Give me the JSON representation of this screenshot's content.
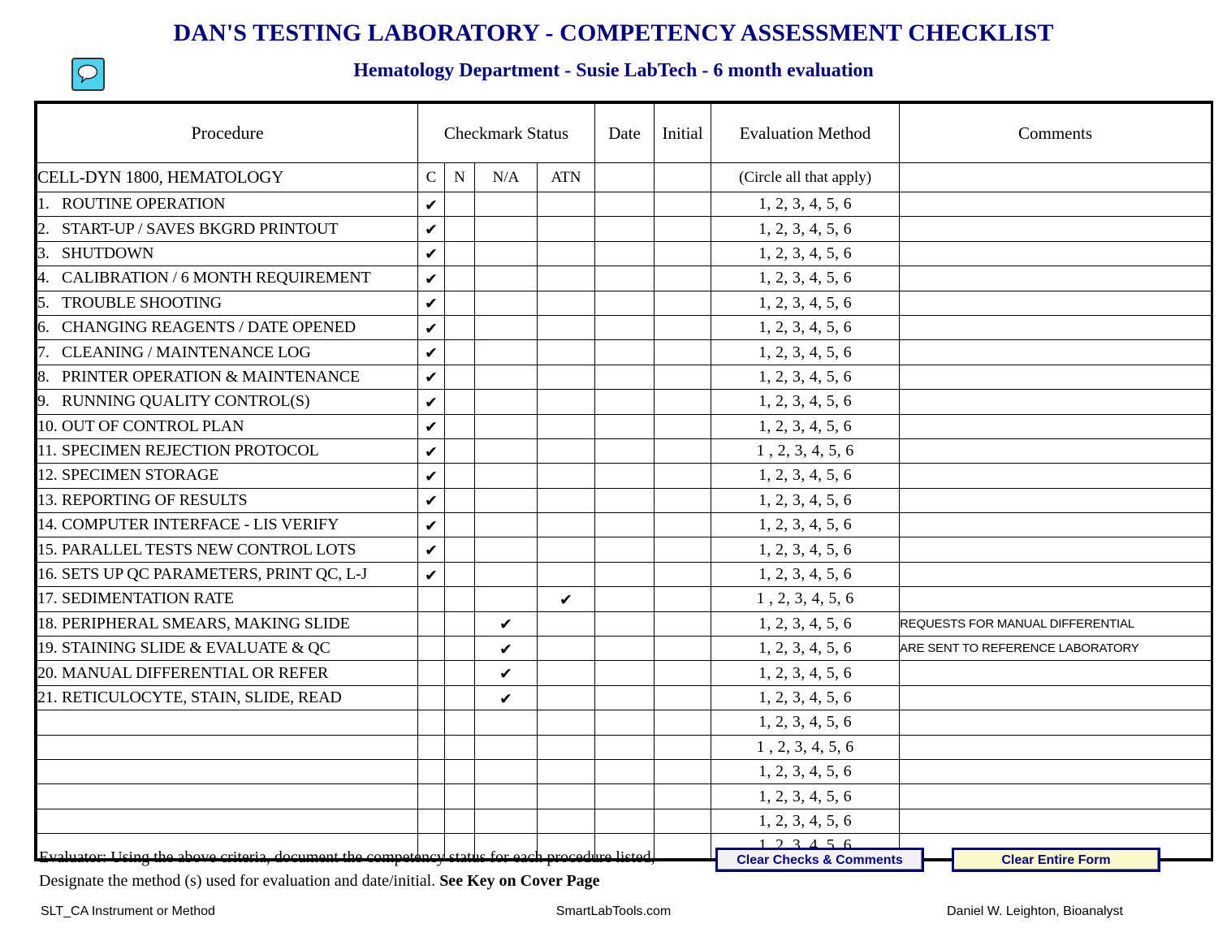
{
  "header": {
    "title": "DAN'S TESTING LABORATORY - COMPETENCY ASSESSMENT CHECKLIST",
    "subtitle": "Hematology Department - Susie LabTech - 6 month evaluation",
    "icon": "comment-bubble-icon",
    "title_color": "#000080",
    "icon_color": "#4DD2EE"
  },
  "table": {
    "columns": {
      "procedure": "Procedure",
      "checkmark_status": "Checkmark Status",
      "date": "Date",
      "initial": "Initial",
      "evaluation_method": "Evaluation Method",
      "comments": "Comments"
    },
    "subcolumns": {
      "c": "C",
      "n": "N",
      "na": "N/A",
      "atn": "ATN"
    },
    "section_title": "CELL-DYN 1800, HEMATOLOGY",
    "circle_note": "(Circle all that apply)",
    "eval_options": "1,  2,  3,  4,  5,  6",
    "check_glyph": "✔",
    "rows": [
      {
        "num": "1.",
        "name": "ROUTINE OPERATION",
        "c": "✔",
        "n": "",
        "na": "",
        "atn": "",
        "date": "",
        "initial": "",
        "eval": "1,  2,  3,  4,  5,  6",
        "comment": ""
      },
      {
        "num": "2.",
        "name": "START-UP / SAVES BKGRD PRINTOUT",
        "c": "✔",
        "n": "",
        "na": "",
        "atn": "",
        "date": "",
        "initial": "",
        "eval": "1,  2,  3,  4,  5,  6",
        "comment": ""
      },
      {
        "num": "3.",
        "name": "SHUTDOWN",
        "c": "✔",
        "n": "",
        "na": "",
        "atn": "",
        "date": "",
        "initial": "",
        "eval": "1,  2,  3,  4,  5,  6",
        "comment": ""
      },
      {
        "num": "4.",
        "name": "CALIBRATION / 6 MONTH REQUIREMENT",
        "c": "✔",
        "n": "",
        "na": "",
        "atn": "",
        "date": "",
        "initial": "",
        "eval": "1,  2,  3,  4,  5,  6",
        "comment": ""
      },
      {
        "num": "5.",
        "name": "TROUBLE SHOOTING",
        "c": "✔",
        "n": "",
        "na": "",
        "atn": "",
        "date": "",
        "initial": "",
        "eval": "1,  2,  3,  4,  5,  6",
        "comment": ""
      },
      {
        "num": "6.",
        "name": "CHANGING REAGENTS / DATE OPENED",
        "c": "✔",
        "n": "",
        "na": "",
        "atn": "",
        "date": "",
        "initial": "",
        "eval": "1,  2,  3,  4,  5,  6",
        "comment": ""
      },
      {
        "num": "7.",
        "name": "CLEANING / MAINTENANCE LOG",
        "c": "✔",
        "n": "",
        "na": "",
        "atn": "",
        "date": "",
        "initial": "",
        "eval": "1,  2,  3,  4,  5,  6",
        "comment": ""
      },
      {
        "num": "8.",
        "name": "PRINTER OPERATION & MAINTENANCE",
        "c": "✔",
        "n": "",
        "na": "",
        "atn": "",
        "date": "",
        "initial": "",
        "eval": "1,  2,  3,  4,  5,  6",
        "comment": ""
      },
      {
        "num": "9.",
        "name": "RUNNING QUALITY CONTROL(S)",
        "c": "✔",
        "n": "",
        "na": "",
        "atn": "",
        "date": "",
        "initial": "",
        "eval": "1,  2,  3,  4,  5,  6",
        "comment": ""
      },
      {
        "num": "10.",
        "name": "OUT OF CONTROL PLAN",
        "c": "✔",
        "n": "",
        "na": "",
        "atn": "",
        "date": "",
        "initial": "",
        "eval": "1,  2,  3,  4,  5,  6",
        "comment": ""
      },
      {
        "num": "11.",
        "name": "SPECIMEN REJECTION PROTOCOL",
        "c": "✔",
        "n": "",
        "na": "",
        "atn": "",
        "date": "",
        "initial": "",
        "eval": "1 ,  2,  3,  4,  5,  6",
        "comment": ""
      },
      {
        "num": "12.",
        "name": "SPECIMEN STORAGE",
        "c": "✔",
        "n": "",
        "na": "",
        "atn": "",
        "date": "",
        "initial": "",
        "eval": "1,  2,  3,  4,  5,  6",
        "comment": ""
      },
      {
        "num": "13.",
        "name": "REPORTING OF RESULTS",
        "c": "✔",
        "n": "",
        "na": "",
        "atn": "",
        "date": "",
        "initial": "",
        "eval": "1,  2,  3,  4,  5,  6",
        "comment": ""
      },
      {
        "num": "14.",
        "name": "COMPUTER INTERFACE - LIS VERIFY",
        "c": "✔",
        "n": "",
        "na": "",
        "atn": "",
        "date": "",
        "initial": "",
        "eval": "1,  2,  3,  4,  5,  6",
        "comment": ""
      },
      {
        "num": "15.",
        "name": "PARALLEL TESTS NEW CONTROL LOTS",
        "c": "✔",
        "n": "",
        "na": "",
        "atn": "",
        "date": "",
        "initial": "",
        "eval": "1,  2,  3,  4,  5,  6",
        "comment": ""
      },
      {
        "num": "16.",
        "name": "SETS UP QC PARAMETERS, PRINT QC, L-J",
        "c": "✔",
        "n": "",
        "na": "",
        "atn": "",
        "date": "",
        "initial": "",
        "eval": "1,  2,  3,  4,  5,  6",
        "comment": ""
      },
      {
        "num": "17.",
        "name": "SEDIMENTATION RATE",
        "c": "",
        "n": "",
        "na": "",
        "atn": "✔",
        "date": "",
        "initial": "",
        "eval": "1 ,  2,  3,  4,  5,  6",
        "comment": ""
      },
      {
        "num": "18.",
        "name": "PERIPHERAL SMEARS, MAKING SLIDE",
        "c": "",
        "n": "",
        "na": "✔",
        "atn": "",
        "date": "",
        "initial": "",
        "eval": "1,  2,  3,  4,  5,  6",
        "comment": "REQUESTS FOR MANUAL DIFFERENTIAL"
      },
      {
        "num": "19.",
        "name": "STAINING SLIDE & EVALUATE & QC",
        "c": "",
        "n": "",
        "na": "✔",
        "atn": "",
        "date": "",
        "initial": "",
        "eval": "1,  2,  3,  4,  5,  6",
        "comment": "ARE SENT TO REFERENCE LABORATORY"
      },
      {
        "num": "20.",
        "name": "MANUAL DIFFERENTIAL OR REFER",
        "c": "",
        "n": "",
        "na": "✔",
        "atn": "",
        "date": "",
        "initial": "",
        "eval": "1,  2,  3,  4,  5,  6",
        "comment": ""
      },
      {
        "num": "21.",
        "name": "RETICULOCYTE, STAIN, SLIDE, READ",
        "c": "",
        "n": "",
        "na": "✔",
        "atn": "",
        "date": "",
        "initial": "",
        "eval": "1,  2,  3,  4,  5,  6",
        "comment": ""
      },
      {
        "num": "",
        "name": "",
        "c": "",
        "n": "",
        "na": "",
        "atn": "",
        "date": "",
        "initial": "",
        "eval": "1,  2,  3,  4,  5,  6",
        "comment": ""
      },
      {
        "num": "",
        "name": "",
        "c": "",
        "n": "",
        "na": "",
        "atn": "",
        "date": "",
        "initial": "",
        "eval": "1 ,  2,  3,  4,  5,  6",
        "comment": ""
      },
      {
        "num": "",
        "name": "",
        "c": "",
        "n": "",
        "na": "",
        "atn": "",
        "date": "",
        "initial": "",
        "eval": "1,  2,  3,  4,  5,  6",
        "comment": ""
      },
      {
        "num": "",
        "name": "",
        "c": "",
        "n": "",
        "na": "",
        "atn": "",
        "date": "",
        "initial": "",
        "eval": "1,  2,  3,  4,  5,  6",
        "comment": ""
      },
      {
        "num": "",
        "name": "",
        "c": "",
        "n": "",
        "na": "",
        "atn": "",
        "date": "",
        "initial": "",
        "eval": "1,  2,  3,  4,  5,  6",
        "comment": ""
      },
      {
        "num": "",
        "name": "",
        "c": "",
        "n": "",
        "na": "",
        "atn": "",
        "date": "",
        "initial": "",
        "eval": "1,  2,  3,  4,  5,  6",
        "comment": ""
      }
    ]
  },
  "bottom": {
    "evaluator_line1": "Evaluator: Using the above criteria, document the competency status for each procedure listed,",
    "evaluator_line2_plain": "Designate the method (s) used for evaluation and date/initial.",
    "evaluator_line2_bold": "See Key on Cover Page",
    "buttons": {
      "clear_checks": "Clear Checks & Comments",
      "clear_form": "Clear Entire Form",
      "clear_checks_bg": "#F2F2F2",
      "clear_form_bg": "#FAFAC8",
      "border_color": "#000080",
      "text_color": "#00008B"
    }
  },
  "footer": {
    "left": "SLT_CA Instrument or Method",
    "center": "SmartLabTools.com",
    "right": "Daniel W. Leighton, Bioanalyst"
  }
}
